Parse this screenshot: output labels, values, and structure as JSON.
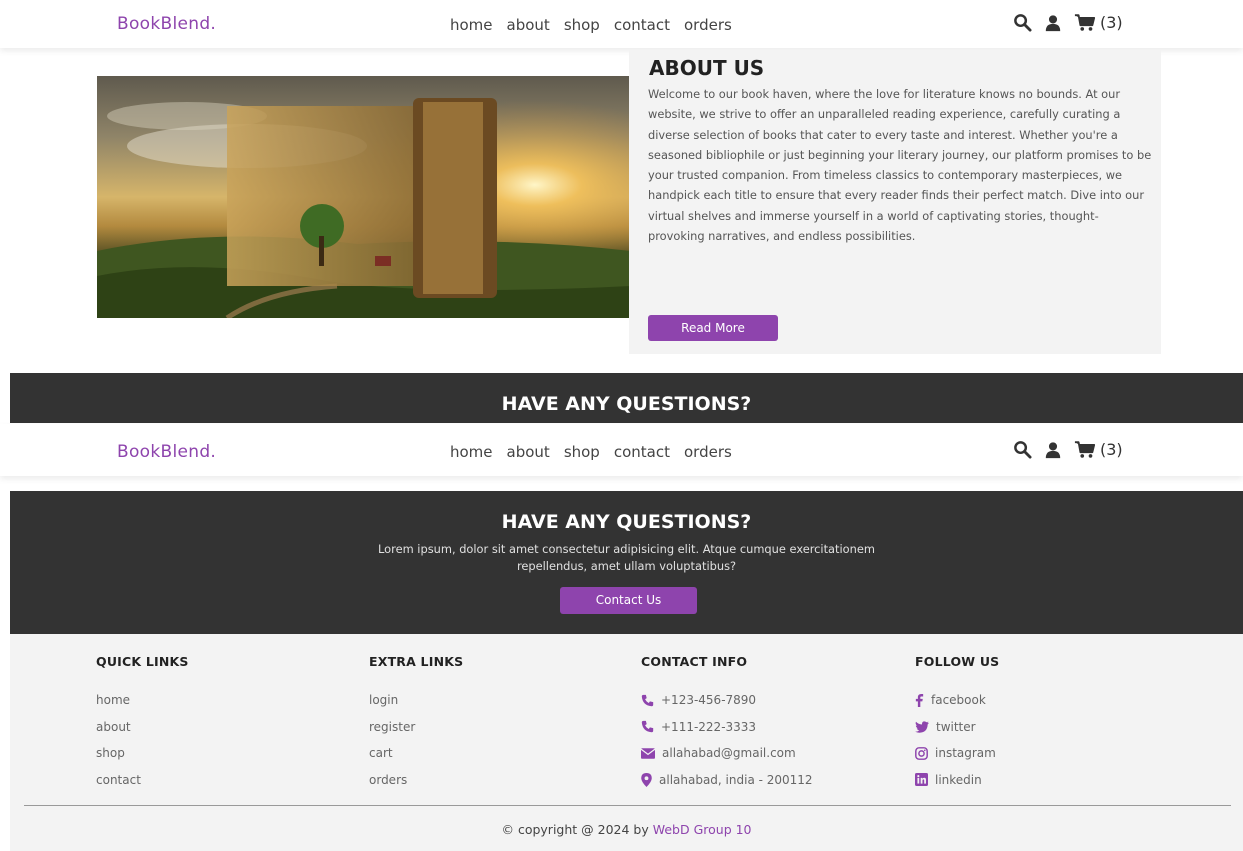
{
  "brand": {
    "logo": "BookBlend.",
    "accent": "#8e44ad"
  },
  "nav": {
    "items": [
      "home",
      "about",
      "shop",
      "contact",
      "orders"
    ]
  },
  "header_icons": [
    "search-icon",
    "user-icon",
    "cart-icon"
  ],
  "cart": {
    "count_label": "(3)"
  },
  "about": {
    "title": "ABOUT US",
    "text": "Welcome to our book haven, where the love for literature knows no bounds. At our website, we strive to offer an unparalleled reading experience, carefully curating a diverse selection of books that cater to every taste and interest. Whether you're a seasoned bibliophile or just beginning your literary journey, our platform promises to be your trusted companion. From timeless classics to contemporary masterpieces, we handpick each title to ensure that every reader finds their perfect match. Dive into our virtual shelves and immerse yourself in a world of captivating stories, thought-provoking narratives, and endless possibilities.",
    "button": "Read More"
  },
  "questions": {
    "title": "HAVE ANY QUESTIONS?",
    "text": "Lorem ipsum, dolor sit amet consectetur adipisicing elit. Atque cumque exercitationem repellendus, amet ullam voluptatibus?",
    "button": "Contact Us"
  },
  "footer": {
    "quick_links": {
      "title": "QUICK LINKS",
      "items": [
        "home",
        "about",
        "shop",
        "contact"
      ]
    },
    "extra_links": {
      "title": "EXTRA LINKS",
      "items": [
        "login",
        "register",
        "cart",
        "orders"
      ]
    },
    "contact_info": {
      "title": "CONTACT INFO",
      "items": [
        {
          "icon": "phone-icon",
          "text": "+123-456-7890"
        },
        {
          "icon": "phone-icon",
          "text": "+111-222-3333"
        },
        {
          "icon": "envelope-icon",
          "text": "allahabad@gmail.com"
        },
        {
          "icon": "map-marker-icon",
          "text": "allahabad, india - 200112"
        }
      ]
    },
    "follow_us": {
      "title": "FOLLOW US",
      "items": [
        {
          "icon": "facebook-icon",
          "text": "facebook"
        },
        {
          "icon": "twitter-icon",
          "text": "twitter"
        },
        {
          "icon": "instagram-icon",
          "text": "instagram"
        },
        {
          "icon": "linkedin-icon",
          "text": "linkedin"
        }
      ]
    },
    "copyright_prefix": "© copyright @ 2024 by ",
    "copyright_brand": "WebD Group 10"
  }
}
